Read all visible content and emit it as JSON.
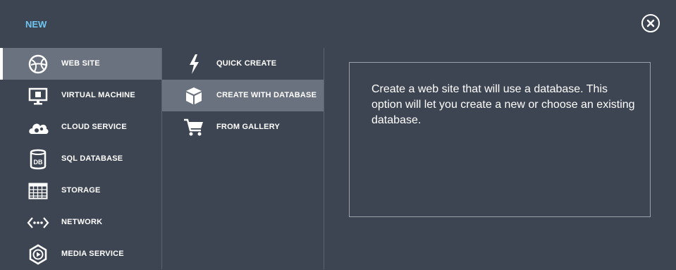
{
  "dialog": {
    "title": "NEW"
  },
  "categories": [
    {
      "label": "WEB SITE",
      "icon": "globe-icon"
    },
    {
      "label": "VIRTUAL MACHINE",
      "icon": "monitor-icon"
    },
    {
      "label": "CLOUD SERVICE",
      "icon": "cloud-gears-icon"
    },
    {
      "label": "SQL DATABASE",
      "icon": "database-icon"
    },
    {
      "label": "STORAGE",
      "icon": "grid-table-icon"
    },
    {
      "label": "NETWORK",
      "icon": "network-icon"
    },
    {
      "label": "MEDIA SERVICE",
      "icon": "media-play-icon"
    }
  ],
  "options": [
    {
      "label": "QUICK CREATE",
      "icon": "lightning-icon"
    },
    {
      "label": "CREATE WITH DATABASE",
      "icon": "cube-icon"
    },
    {
      "label": "FROM GALLERY",
      "icon": "shopping-cart-icon"
    }
  ],
  "selected": {
    "category": "WEB SITE",
    "option": "CREATE WITH DATABASE"
  },
  "description": "Create a web site that will use a database. This option will let you create a new or choose an existing database.",
  "colors": {
    "background": "#3e4552",
    "selected": "#6b727f",
    "title_accent": "#6ec6f0"
  }
}
